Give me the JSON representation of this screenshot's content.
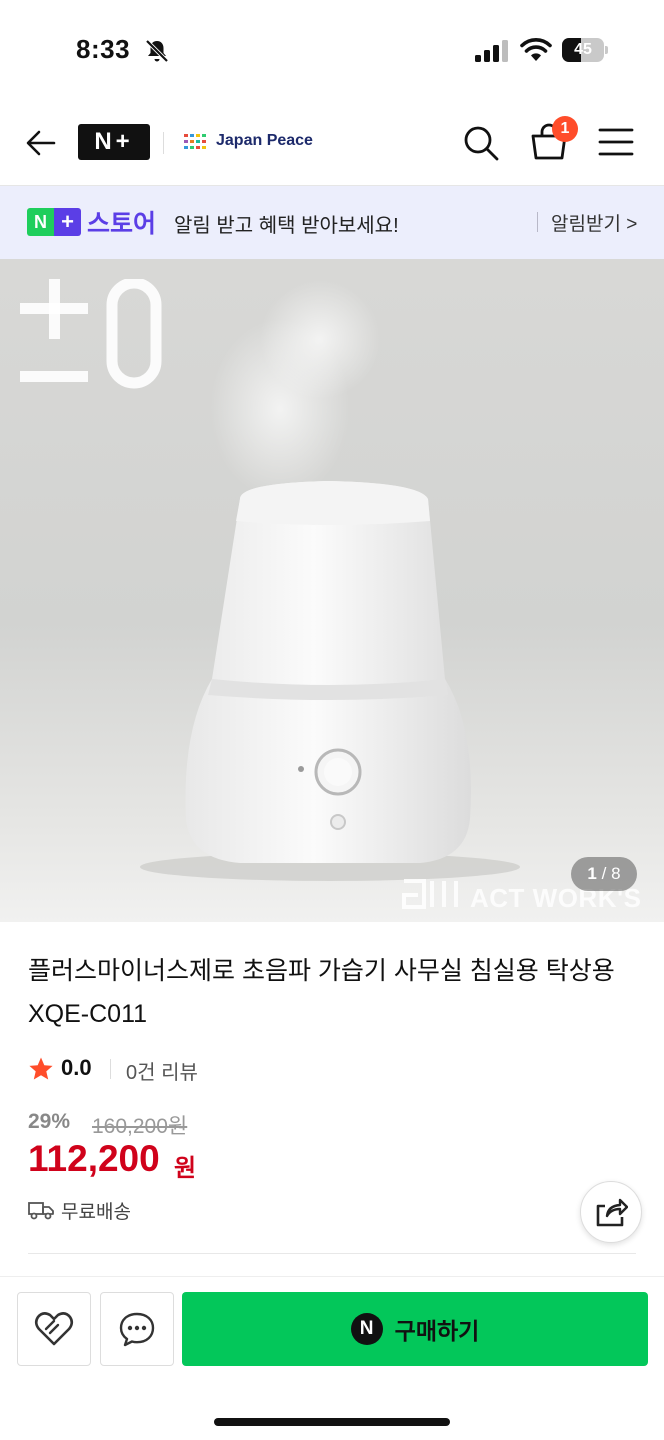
{
  "status_bar": {
    "time": "8:33",
    "battery_level": "45",
    "battery_fraction": 0.45
  },
  "header": {
    "logo_text": "N+",
    "store_name": "Japan Peace",
    "cart_count": "1",
    "icons": [
      "back-arrow-icon",
      "search-icon",
      "cart-icon",
      "menu-icon"
    ]
  },
  "banner": {
    "logo_n": "N",
    "logo_plus": "+",
    "store_label": "스토어",
    "message": "알림 받고 혜택 받아보세요!",
    "action_label": "알림받기 >"
  },
  "gallery": {
    "current_index": "1",
    "total": "8",
    "separator": "/",
    "brand_text": "±0",
    "watermark": "ACT WORK'S"
  },
  "product": {
    "title": "플러스마이너스제로 초음파 가습기 사무실 침실용 탁상용 XQE-C011",
    "rating": "0.0",
    "review_count": "0건 리뷰",
    "discount_rate": "29%",
    "original_price": "160,200원",
    "sale_price": "112,200",
    "price_unit": "원",
    "shipping": "무료배송"
  },
  "actions": {
    "buy_icon_letter": "N",
    "buy_label": "구매하기"
  },
  "colors": {
    "naver_green": "#03c75a",
    "store_purple": "#5b3ee6",
    "price_red": "#d0021b",
    "badge_orange": "#ff4d2a",
    "banner_bg": "#eceefc",
    "star": "#ff4d2a"
  }
}
